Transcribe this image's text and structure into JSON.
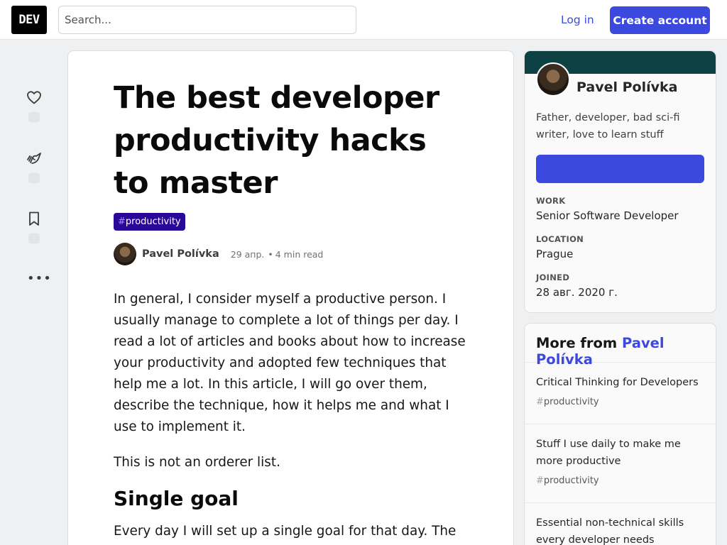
{
  "header": {
    "logo": "DEV",
    "search_placeholder": "Search...",
    "login": "Log in",
    "create_account": "Create account"
  },
  "reactions": [
    {
      "icon": "heart-icon"
    },
    {
      "icon": "unicorn-icon"
    },
    {
      "icon": "bookmark-icon"
    }
  ],
  "more_options_icon": "ellipsis-icon",
  "article": {
    "title": "The best developer productivity hacks to master",
    "tag_hash": "#",
    "tag": "productivity",
    "author": "Pavel Polívka",
    "date": "29 апр.",
    "separator": "•",
    "read_time": "4 min read",
    "paragraph_1": "In general, I consider myself a productive person. I usually manage to complete a lot of things per day. I read a lot of articles and books about how to increase your productivity and adopted few techniques that help me a lot. In this article, I will go over them, describe the technique, how it helps me and what I use to implement it.",
    "paragraph_2": "This is not an orderer list.",
    "heading_1": "Single goal",
    "paragraph_3": "Every day I will set up a single goal for that day. The one"
  },
  "author_card": {
    "name": "Pavel Polívka",
    "bio": "Father, developer, bad sci-fi writer, love to learn stuff",
    "work_label": "WORK",
    "work_value": "Senior Software Developer",
    "location_label": "LOCATION",
    "location_value": "Prague",
    "joined_label": "JOINED",
    "joined_value": "28 авг. 2020 г.",
    "band_color": "#0d4143"
  },
  "more_from": {
    "prefix": "More from",
    "author": "Pavel Polívka",
    "items": [
      {
        "title": "Critical Thinking for Developers",
        "tag_hash": "#",
        "tag": "productivity"
      },
      {
        "title": "Stuff I use daily to make me more productive",
        "tag_hash": "#",
        "tag": "productivity"
      },
      {
        "title": "Essential non-technical skills every developer needs",
        "tag_hash": "",
        "tag": ""
      }
    ]
  },
  "colors": {
    "accent": "#3b49df",
    "tag_bg": "#2a0798"
  }
}
